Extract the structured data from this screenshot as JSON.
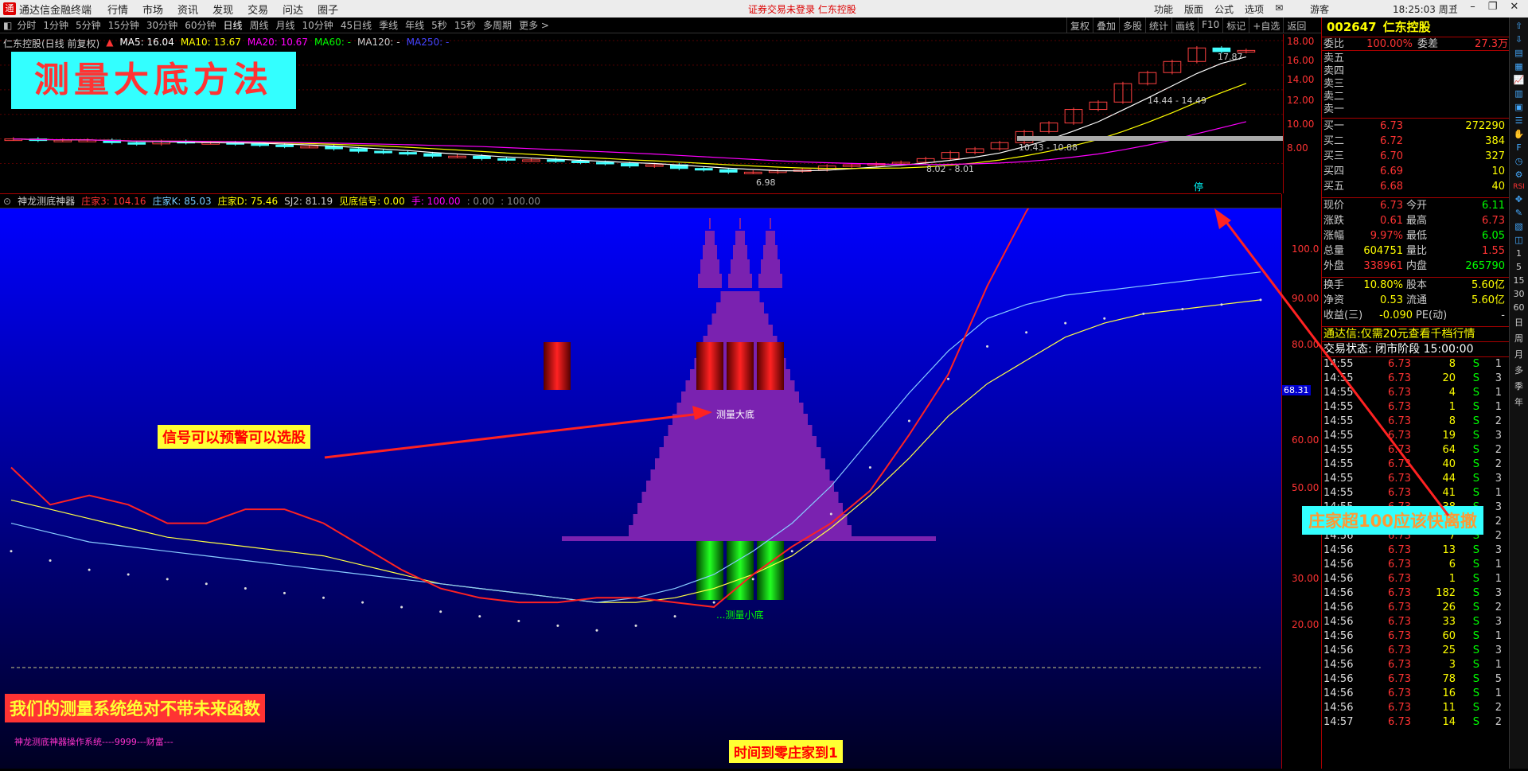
{
  "titlebar": {
    "app_name": "通达信金融终端",
    "menus": [
      "行情",
      "市场",
      "资讯",
      "发现",
      "交易",
      "问达",
      "圈子"
    ],
    "center_text": "证券交易未登录   仁东控股",
    "right_menus": [
      "功能",
      "版面",
      "公式",
      "选项"
    ],
    "user": "游客",
    "clock": "18:25:03 周五"
  },
  "periods": [
    "分时",
    "1分钟",
    "5分钟",
    "15分钟",
    "30分钟",
    "60分钟",
    "日线",
    "周线",
    "月线",
    "10分钟",
    "45日线",
    "季线",
    "年线",
    "5秒",
    "15秒",
    "多周期",
    "更多 >"
  ],
  "active_period": "日线",
  "tools": [
    "复权",
    "叠加",
    "多股",
    "统计",
    "画线",
    "F10",
    "标记",
    "+自选",
    "返回"
  ],
  "main_chart": {
    "stock_label": "仁东控股(日线 前复权)",
    "ma": [
      "MA5: 16.04",
      "MA10: 13.67",
      "MA20: 10.67",
      "MA60: -",
      "MA120: -",
      "MA250: -"
    ],
    "banner": "测量大底方法",
    "annotations": [
      "17.87",
      "14.44 - 14.49",
      "10.43 - 10.88",
      "8.02 - 8.01",
      "6.98"
    ],
    "y_ticks": [
      "18.00",
      "16.00",
      "14.00",
      "12.00",
      "10.00",
      "8.00"
    ],
    "suspend_mark": "停",
    "closes": [
      10.0,
      9.9,
      9.9,
      9.9,
      9.7,
      9.6,
      9.8,
      9.7,
      9.7,
      9.6,
      9.5,
      9.4,
      9.4,
      9.2,
      9.0,
      8.9,
      8.8,
      8.6,
      8.6,
      8.4,
      8.3,
      8.3,
      8.2,
      8.1,
      8.0,
      7.8,
      7.9,
      7.6,
      7.5,
      7.3,
      7.3,
      7.4,
      7.5,
      7.8,
      7.9,
      8.0,
      8.1,
      8.4,
      8.9,
      9.2,
      9.7,
      10.6,
      11.3,
      12.4,
      13.0,
      14.5,
      15.4,
      16.3,
      17.4,
      17.1,
      17.2
    ]
  },
  "indicator": {
    "name": "神龙测底神器",
    "values": [
      {
        "text": "庄家3: 104.16",
        "color": "#f33"
      },
      {
        "text": "庄家K: 85.03",
        "color": "#7cf"
      },
      {
        "text": "庄家D: 75.46",
        "color": "#ff0"
      },
      {
        "text": "SJ2: 81.19",
        "color": "#ccc"
      },
      {
        "text": "见底信号: 0.00",
        "color": "#ff0"
      },
      {
        "text": "手: 100.00",
        "color": "#f0f"
      },
      {
        "text": ": 0.00",
        "color": "#888"
      },
      {
        "text": ": 100.00",
        "color": "#888"
      }
    ],
    "label_bottom_big": "测量大底",
    "label_bottom_small": "...测量小底",
    "note_signal": "信号可以预警可以选股",
    "note_nofuture": "我们的测量系统绝对不带未来函数",
    "note_time": "时间到零庄家到1",
    "note_sell": "庄家超100应该快离撤",
    "footer": "神龙测底神器操作系统----9999---财富---",
    "y_ticks": [
      "100.0",
      "90.00",
      "80.00",
      "70.00",
      "60.00",
      "50.00",
      "40.00",
      "30.00",
      "20.00"
    ],
    "cursor_value": "68.31",
    "red_line": [
      43,
      35,
      37,
      35,
      31,
      31,
      34,
      34,
      31,
      26,
      21,
      17,
      15,
      14,
      14,
      15,
      15,
      14,
      13,
      20,
      26,
      31,
      38,
      50,
      63,
      82,
      98,
      111,
      121,
      131,
      134,
      131,
      127
    ],
    "cyan_line": [
      31,
      29,
      27,
      26,
      25,
      24,
      23,
      22,
      21,
      20,
      19,
      18,
      17,
      16,
      15,
      14,
      15,
      17,
      20,
      25,
      31,
      39,
      49,
      59,
      68,
      75,
      78,
      80,
      81,
      82,
      83,
      84,
      85
    ],
    "yellow_line": [
      36,
      34,
      32,
      30,
      28,
      27,
      26,
      25,
      24,
      22,
      20,
      18,
      17,
      16,
      15,
      14,
      14,
      15,
      17,
      20,
      24,
      30,
      37,
      45,
      54,
      61,
      66,
      71,
      74,
      76,
      77,
      78,
      79
    ]
  },
  "quote": {
    "code": "002647",
    "name": "仁东控股",
    "wb_label": "委比",
    "wb_value": "100.00%",
    "wc_label": "委差",
    "wc_value": "27.3万",
    "sells": [
      {
        "label": "卖五"
      },
      {
        "label": "卖四"
      },
      {
        "label": "卖三"
      },
      {
        "label": "卖二"
      },
      {
        "label": "卖一"
      }
    ],
    "buys": [
      {
        "label": "买一",
        "price": "6.73",
        "vol": "272290"
      },
      {
        "label": "买二",
        "price": "6.72",
        "vol": "384"
      },
      {
        "label": "买三",
        "price": "6.70",
        "vol": "327"
      },
      {
        "label": "买四",
        "price": "6.69",
        "vol": "10"
      },
      {
        "label": "买五",
        "price": "6.68",
        "vol": "40"
      }
    ],
    "stats": [
      {
        "l1": "现价",
        "v1": "6.73",
        "l2": "今开",
        "v2": "6.11"
      },
      {
        "l1": "涨跌",
        "v1": "0.61",
        "l2": "最高",
        "v2": "6.73"
      },
      {
        "l1": "涨幅",
        "v1": "9.97%",
        "l2": "最低",
        "v2": "6.05"
      },
      {
        "l1": "总量",
        "v1": "604751",
        "l2": "量比",
        "v2": "1.55"
      },
      {
        "l1": "外盘",
        "v1": "338961",
        "l2": "内盘",
        "v2": "265790"
      }
    ],
    "stats2": [
      {
        "l1": "换手",
        "v1": "10.80%",
        "l2": "股本",
        "v2": "5.60亿"
      },
      {
        "l1": "净资",
        "v1": "0.53",
        "l2": "流通",
        "v2": "5.60亿"
      },
      {
        "l1": "收益(三)",
        "v1": "-0.090",
        "l2": "PE(动)",
        "v2": "-"
      }
    ],
    "promo": "通达信:仅需20元查看千档行情",
    "status": "交易状态: 闭市阶段 15:00:00"
  },
  "ticks": [
    [
      "14:55",
      "6.73",
      "8",
      "S",
      "1"
    ],
    [
      "14:55",
      "6.73",
      "20",
      "S",
      "3"
    ],
    [
      "14:55",
      "6.73",
      "4",
      "S",
      "1"
    ],
    [
      "14:55",
      "6.73",
      "1",
      "S",
      "1"
    ],
    [
      "14:55",
      "6.73",
      "8",
      "S",
      "2"
    ],
    [
      "14:55",
      "6.73",
      "19",
      "S",
      "3"
    ],
    [
      "14:55",
      "6.73",
      "64",
      "S",
      "2"
    ],
    [
      "14:55",
      "6.73",
      "40",
      "S",
      "2"
    ],
    [
      "14:55",
      "6.73",
      "44",
      "S",
      "3"
    ],
    [
      "14:55",
      "6.73",
      "41",
      "S",
      "1"
    ],
    [
      "14:55",
      "6.73",
      "38",
      "S",
      "3"
    ],
    [
      "14:56",
      "6.73",
      "9",
      "S",
      "2"
    ],
    [
      "14:56",
      "6.73",
      "7",
      "S",
      "2"
    ],
    [
      "14:56",
      "6.73",
      "13",
      "S",
      "3"
    ],
    [
      "14:56",
      "6.73",
      "6",
      "S",
      "1"
    ],
    [
      "14:56",
      "6.73",
      "1",
      "S",
      "1"
    ],
    [
      "14:56",
      "6.73",
      "182",
      "S",
      "3"
    ],
    [
      "14:56",
      "6.73",
      "26",
      "S",
      "2"
    ],
    [
      "14:56",
      "6.73",
      "33",
      "S",
      "3"
    ],
    [
      "14:56",
      "6.73",
      "60",
      "S",
      "1"
    ],
    [
      "14:56",
      "6.73",
      "25",
      "S",
      "3"
    ],
    [
      "14:56",
      "6.73",
      "3",
      "S",
      "1"
    ],
    [
      "14:56",
      "6.73",
      "78",
      "S",
      "5"
    ],
    [
      "14:56",
      "6.73",
      "16",
      "S",
      "1"
    ],
    [
      "14:56",
      "6.73",
      "11",
      "S",
      "2"
    ],
    [
      "14:57",
      "6.73",
      "14",
      "S",
      "2"
    ]
  ],
  "sidebar_periods": [
    "1",
    "5",
    "15",
    "30",
    "60",
    "日",
    "周",
    "月",
    "多",
    "季",
    "年"
  ],
  "colors": {
    "accent_red": "#ff3333",
    "banner_bg": "#33ffff",
    "note_bg": "#ffff33",
    "indicator_bg_top": "#0000ff",
    "indicator_bg_bottom": "#000022",
    "purple": "#7a22b0"
  }
}
